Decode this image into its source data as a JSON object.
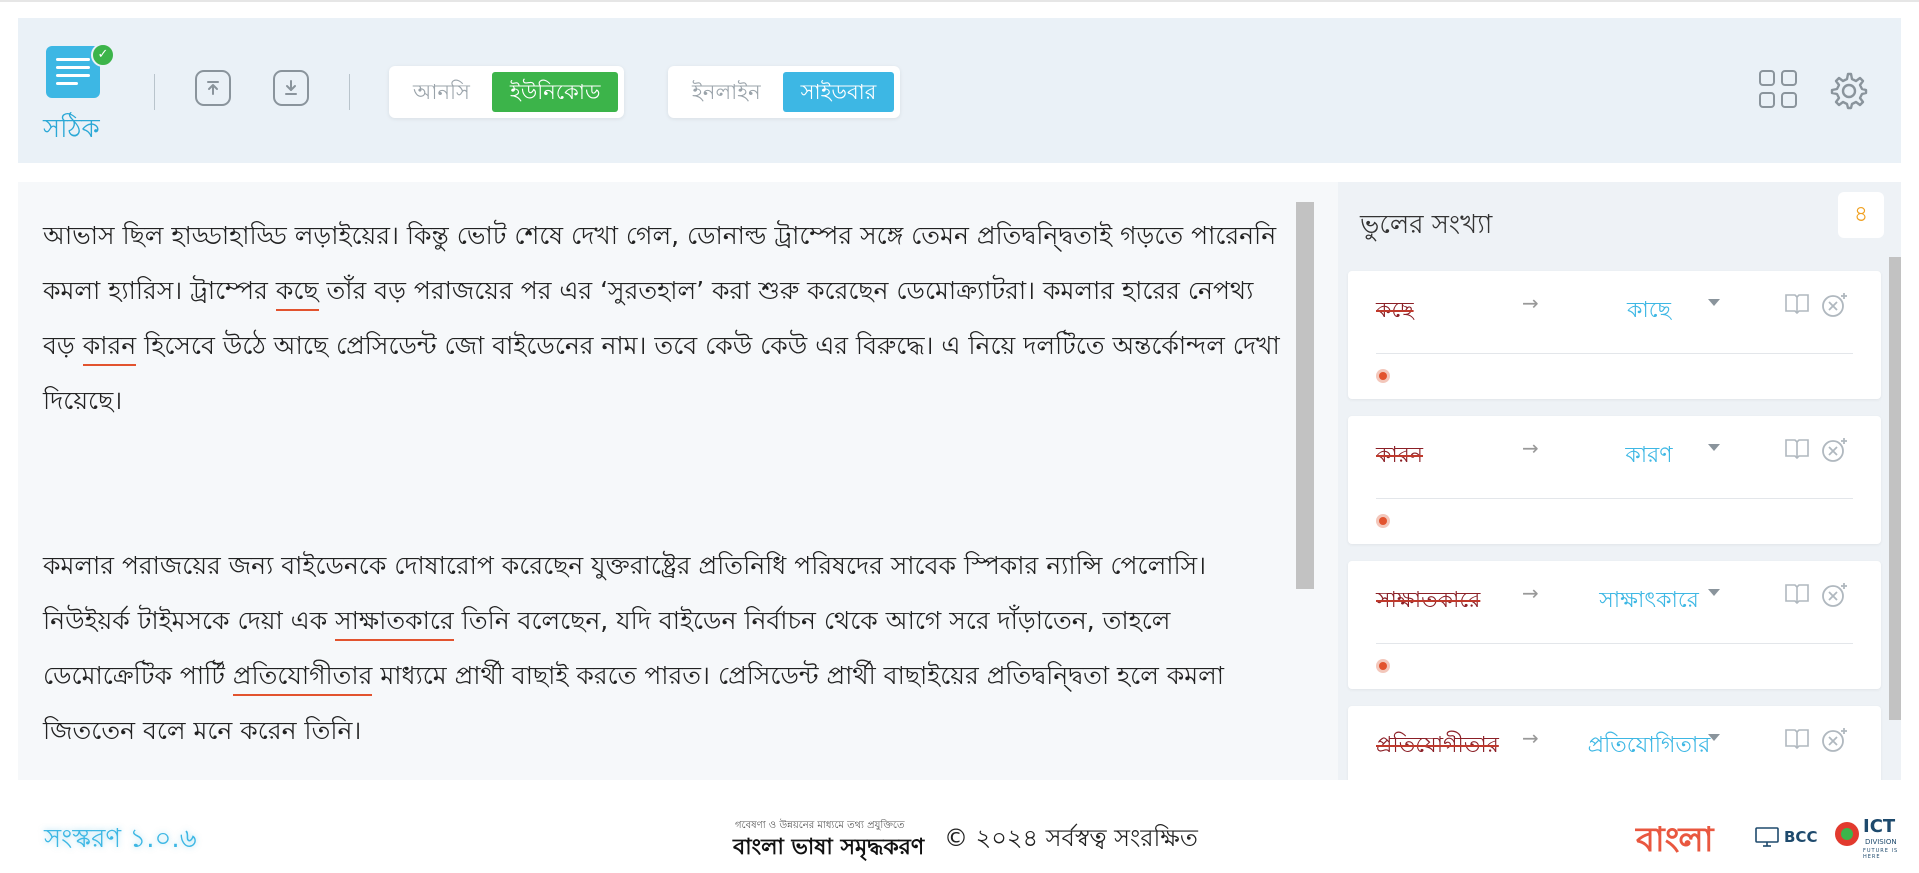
{
  "app": {
    "name": "সঠিক"
  },
  "toolbar": {
    "encoding_options": [
      "আনসি",
      "ইউনিকোড"
    ],
    "encoding_selected": "ইউনিকোড",
    "view_options": [
      "ইনলাইন",
      "সাইডবার"
    ],
    "view_selected": "সাইডবার",
    "icons": [
      "upload-icon",
      "download-icon",
      "grid-icon",
      "gear-icon"
    ]
  },
  "editor": {
    "paragraph1": [
      "আভাস ছিল হাড্ডাহাড্ডি লড়াইয়ের। কিন্তু ভোট শেষে দেখা গেল, ডোনাল্ড ট্রাম্পের সঙ্গে তেমন প্রতিদ্বন্দ্বিতাই গড়তে পারেননি কমলা হ্যারিস। ট্রাম্পের ",
      "কছে",
      " তাঁর বড় পরাজয়ের পর এর ‘সুরতহাল’ করা শুরু করেছেন ডেমোক্র্যাটরা। কমলার হারের নেপথ্য বড় ",
      "কারন",
      " হিসেবে উঠে আছে প্রেসিডেন্ট জো বাইডেনের নাম। তবে কেউ কেউ এর বিরুদ্ধে। এ নিয়ে দলটিতে অন্তর্কোন্দল দেখা দিয়েছে।"
    ],
    "paragraph2": [
      "কমলার পরাজয়ের জন্য বাইডেনকে দোষারোপ করেছেন যুক্তরাষ্ট্রের প্রতিনিধি পরিষদের সাবেক স্পিকার ন্যান্সি পেলোসি। নিউইয়র্ক টাইমসকে দেয়া এক ",
      "সাক্ষাতকারে",
      " তিনি বলেছেন, যদি বাইডেন নির্বাচন থেকে আগে সরে দাঁড়াতেন, তাহলে ডেমোক্রেটিক পার্টি ",
      "প্রতিযোগীতার",
      " মাধ্যমে প্রার্থী বাছাই করতে পারত। প্রেসিডেন্ট প্রার্থী বাছাইয়ের প্রতিদ্বন্দ্বিতা হলে কমলা জিততেন বলে মনে করেন তিনি।"
    ],
    "error_color": "#e2532e"
  },
  "sidebar": {
    "title": "ভুলের সংখ্যা",
    "count": "৪",
    "suggestions": [
      {
        "wrong": "কছে",
        "right": "কাছে"
      },
      {
        "wrong": "কারন",
        "right": "কারণ"
      },
      {
        "wrong": "সাক্ষাতকারে",
        "right": "সাক্ষাৎকারে"
      },
      {
        "wrong": "প্রতিযোগীতার",
        "right": "প্রতিযোগিতার"
      }
    ]
  },
  "footer": {
    "version": "সংস্করণ ১.০.৬",
    "funding_small": "গবেষণা ও উন্নয়নের মাধ্যমে তথ্য প্রযুক্তিতে",
    "funding_big": "বাংলা ভাষা সমৃদ্ধকরণ",
    "copyright": "© ২০২৪ সর্বস্বত্ব সংরক্ষিত",
    "logos": {
      "bangla": "বাংলা",
      "bcc": "BCC",
      "ict": "ICT",
      "ict_division": "DIVISION",
      "ict_tagline": "FUTURE IS HERE"
    }
  },
  "colors": {
    "accent_blue": "#3db7e4",
    "accent_green": "#3cb44a",
    "header_bg": "#eaf1f7",
    "count_orange": "#f0a020"
  }
}
